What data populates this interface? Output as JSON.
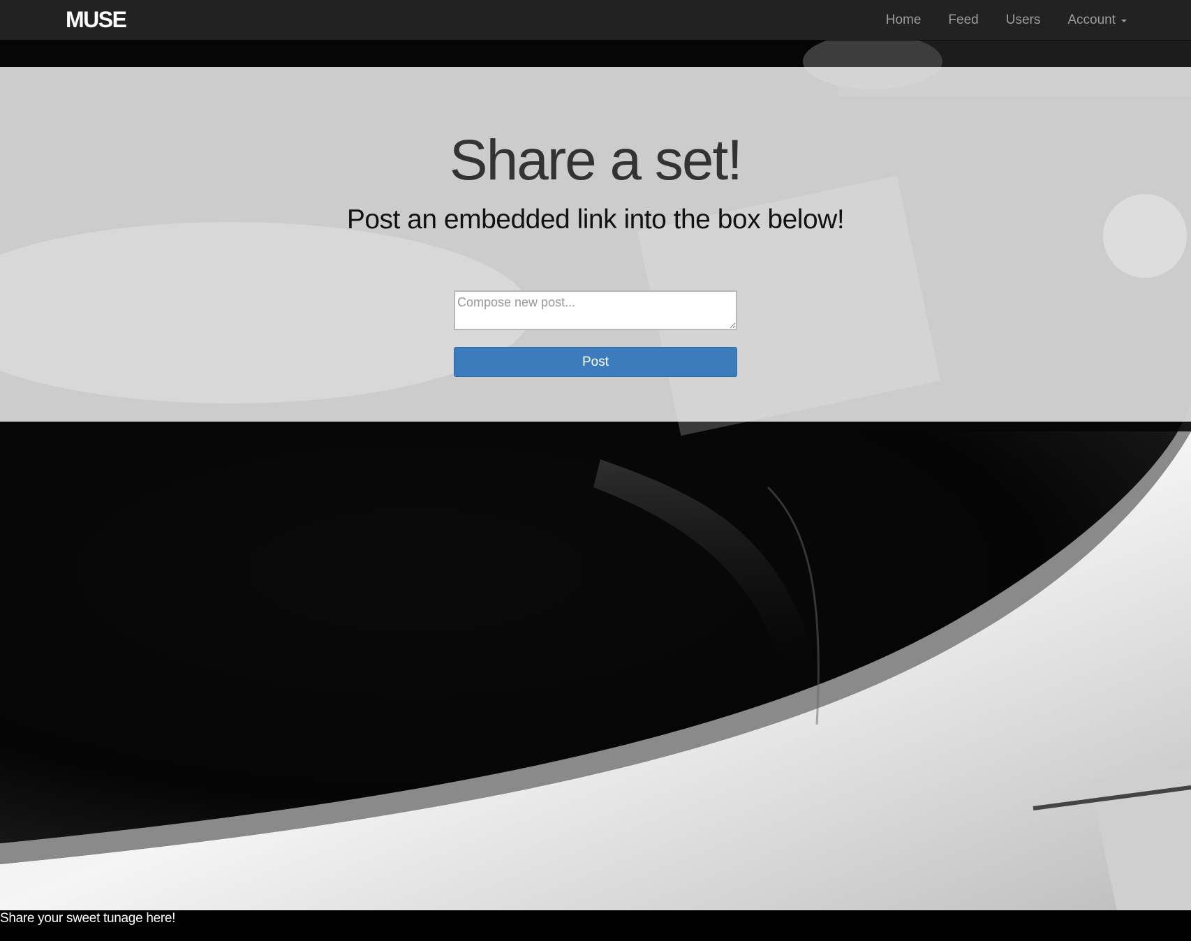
{
  "navbar": {
    "brand": "MUSE",
    "links": [
      {
        "label": "Home"
      },
      {
        "label": "Feed"
      },
      {
        "label": "Users"
      },
      {
        "label": "Account"
      }
    ]
  },
  "hero": {
    "title": "Share a set!",
    "subtitle": "Post an embedded link into the box below!",
    "compose_placeholder": "Compose new post...",
    "compose_value": "",
    "post_button": "Post"
  },
  "footer": {
    "text": "Share your sweet tunage here!"
  },
  "colors": {
    "navbar_bg": "#222222",
    "primary_button": "#3c7cbd",
    "jumbotron_overlay": "#eeeeee"
  }
}
